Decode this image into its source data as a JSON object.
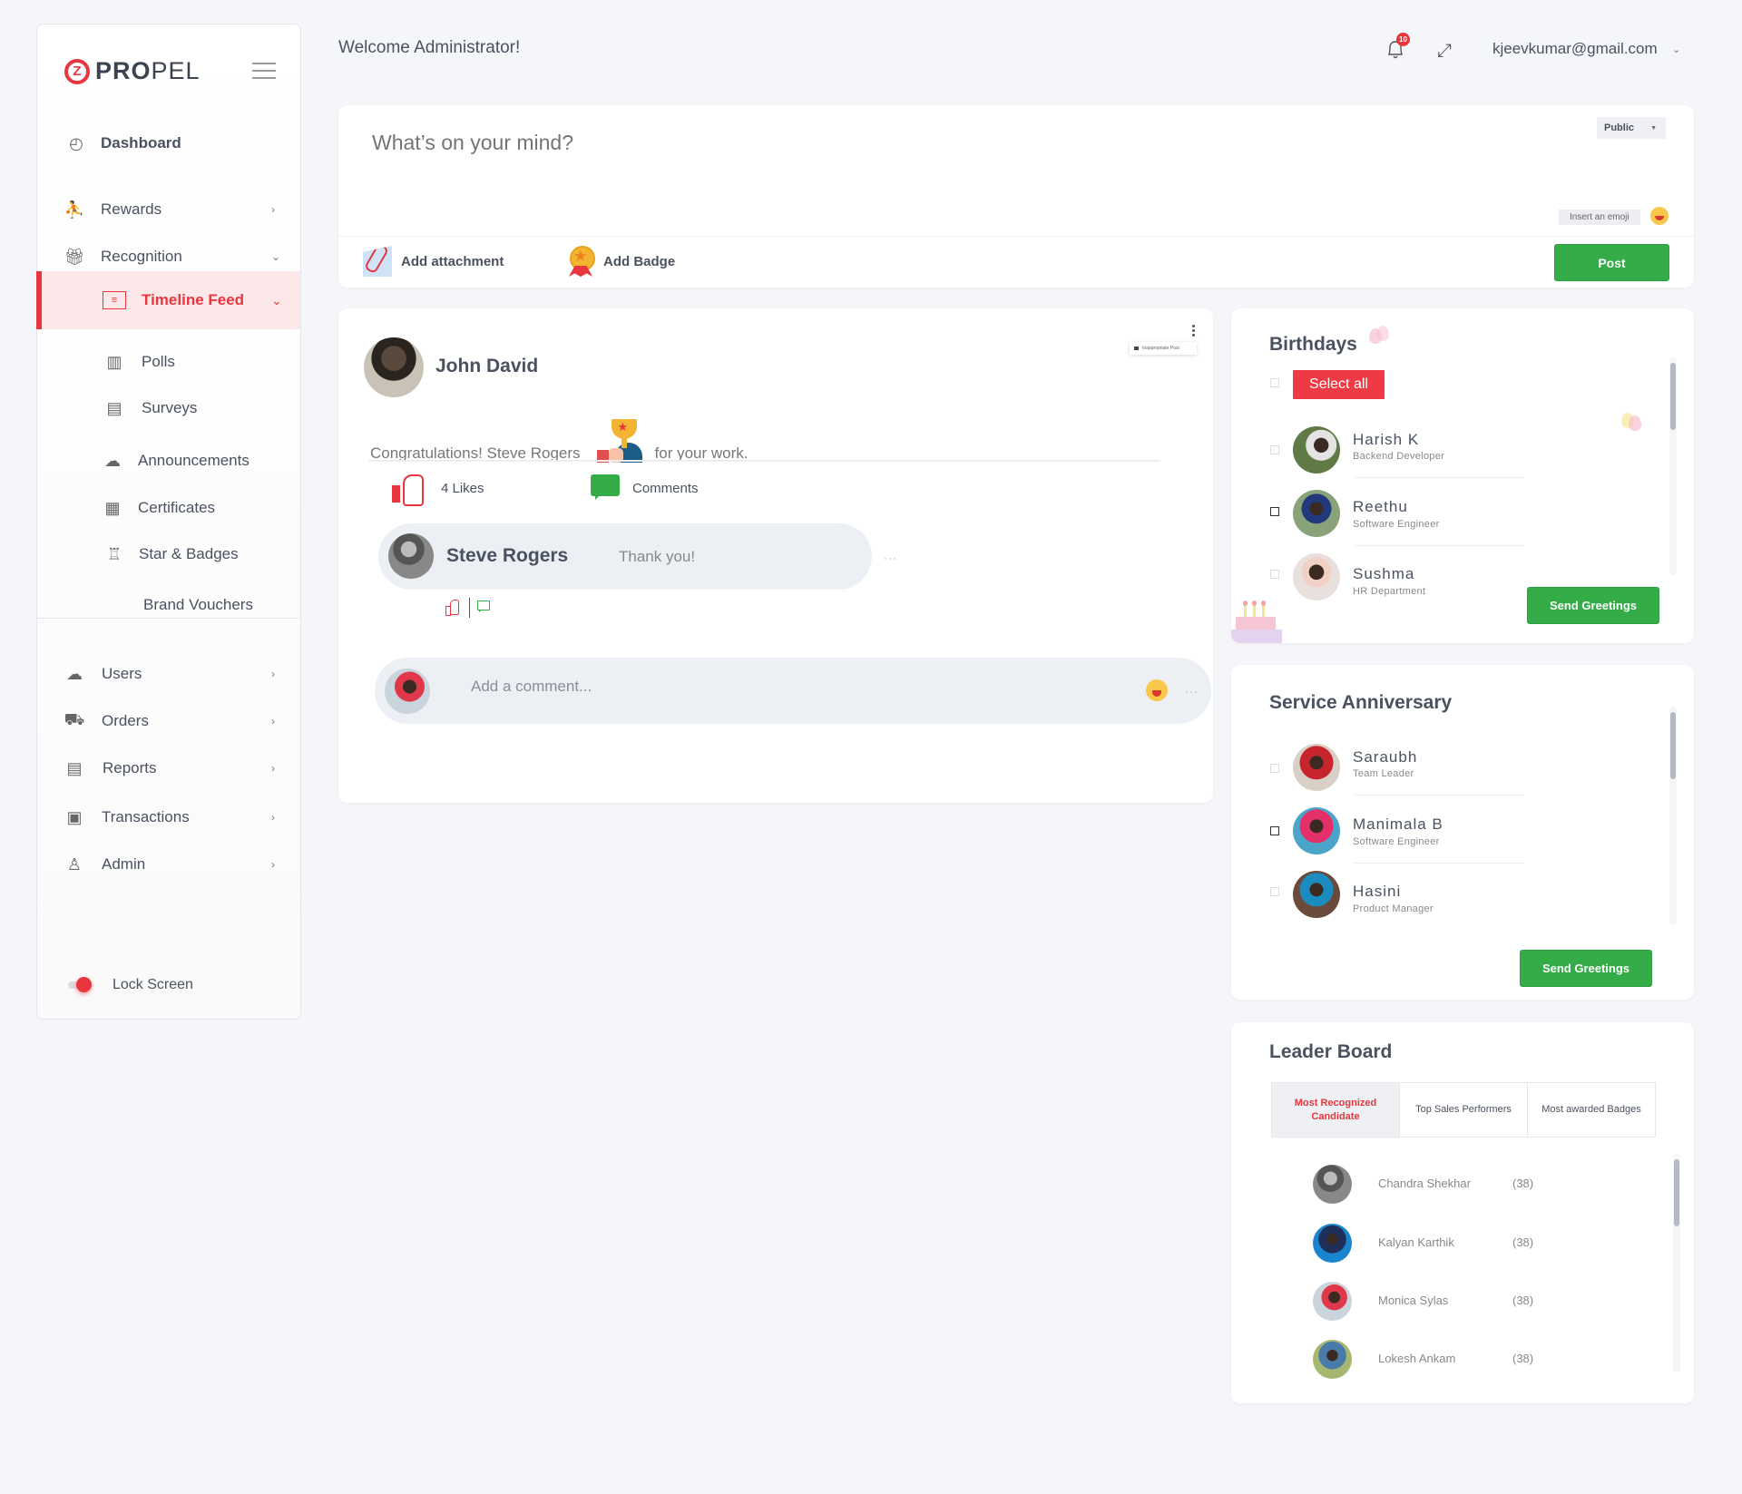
{
  "brand": {
    "name_bold": "PRO",
    "name_light": "PEL",
    "logo_letter": "Z"
  },
  "sidebar": {
    "items": [
      {
        "label": "Dashboard",
        "icon": "gauge-icon"
      },
      {
        "label": "Rewards",
        "icon": "presenter-icon"
      },
      {
        "label": "Recognition",
        "icon": "gift-icon"
      },
      {
        "label": "Timeline Feed",
        "icon": "feed-icon",
        "active": true
      },
      {
        "label": "Polls",
        "icon": "poll-icon"
      },
      {
        "label": "Surveys",
        "icon": "survey-icon"
      },
      {
        "label": "Announcements",
        "icon": "group-icon"
      },
      {
        "label": "Certificates",
        "icon": "certificate-icon"
      },
      {
        "label": "Star & Badges",
        "icon": "trophy-icon"
      },
      {
        "label": "Brand Vouchers",
        "icon": ""
      },
      {
        "label": "Users",
        "icon": "users-icon"
      },
      {
        "label": "Orders",
        "icon": "cart-icon"
      },
      {
        "label": "Reports",
        "icon": "report-icon"
      },
      {
        "label": "Transactions",
        "icon": "transaction-icon"
      },
      {
        "label": "Admin",
        "icon": "admin-icon"
      }
    ],
    "lock_screen": "Lock Screen"
  },
  "header": {
    "welcome": "Welcome Administrator!",
    "notifications_count": "10",
    "user_email": "kjeevkumar@gmail.com"
  },
  "composer": {
    "placeholder": "What’s on your mind?",
    "visibility": "Public",
    "emoji_tooltip": "Insert an emoji",
    "add_attachment": "Add attachment",
    "add_badge": "Add Badge",
    "post_label": "Post"
  },
  "post": {
    "author": "John David",
    "menu_option": "Inappropriate Post",
    "message_before": "Congratulations! Steve Rogers",
    "message_after": "for your work.",
    "likes": "4 Likes",
    "comments": "Comments",
    "reply": {
      "name": "Steve Rogers",
      "text": "Thank you!"
    },
    "comment_placeholder": "Add a comment...",
    "more": "···"
  },
  "birthdays": {
    "title": "Birthdays",
    "select_all": "Select all",
    "people": [
      {
        "name": "Harish K",
        "role": "Backend Developer"
      },
      {
        "name": "Reethu",
        "role": "Software Engineer"
      },
      {
        "name": "Sushma",
        "role": "HR Department"
      }
    ],
    "send": "Send Greetings"
  },
  "anniversary": {
    "title": "Service Anniversary",
    "people": [
      {
        "name": "Saraubh",
        "role": "Team Leader"
      },
      {
        "name": "Manimala B",
        "role": "Software Engineer"
      },
      {
        "name": "Hasini",
        "role": "Product Manager"
      }
    ],
    "send": "Send Greetings"
  },
  "leaderboard": {
    "title": "Leader Board",
    "tabs": [
      "Most Recognized Candidate",
      "Top Sales Performers",
      "Most awarded Badges"
    ],
    "rows": [
      {
        "name": "Chandra Shekhar",
        "count": "(38)"
      },
      {
        "name": "Kalyan Karthik",
        "count": "(38)"
      },
      {
        "name": "Monica Sylas",
        "count": "(38)"
      },
      {
        "name": "Lokesh Ankam",
        "count": "(38)"
      }
    ]
  },
  "colors": {
    "accent": "#e8363e",
    "success": "#34ad48",
    "background": "#f5f6fa",
    "text": "#4a5260"
  }
}
